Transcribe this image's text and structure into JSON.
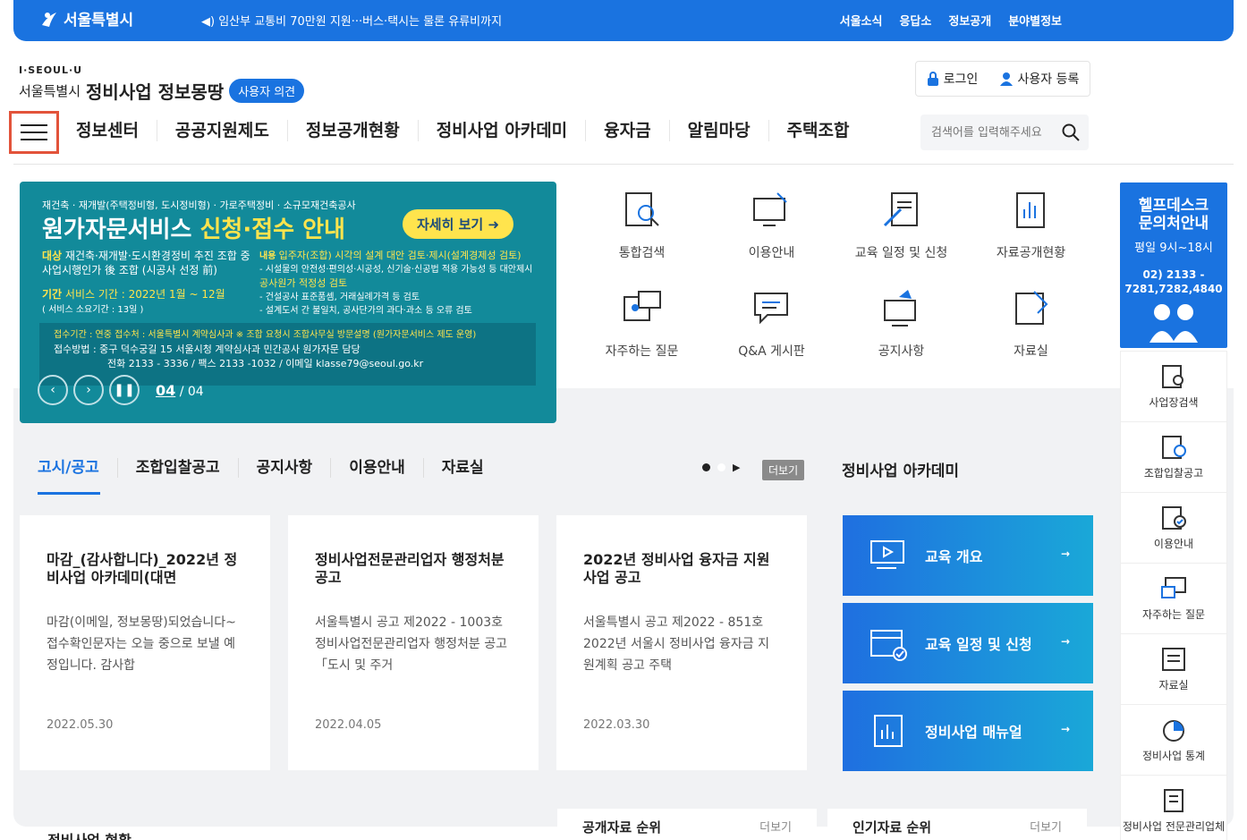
{
  "topbar": {
    "logo": "서울특별시",
    "notice": "◀) 임산부 교통비 70만원 지원···버스·택시는 물론 유류비까지",
    "links": [
      "서울소식",
      "응답소",
      "정보공개",
      "분야별정보"
    ]
  },
  "brand": {
    "slogan": "I·SEOUL·U",
    "city": "서울특별시",
    "title": "정비사업 정보몽땅",
    "badge": "사용자 의견"
  },
  "auth": {
    "login": "로그인",
    "register": "사용자 등록"
  },
  "gnb": [
    "정보센터",
    "공공지원제도",
    "정보공개현황",
    "정비사업 아카데미",
    "융자금",
    "알림마당",
    "주택조합"
  ],
  "search": {
    "placeholder": "검색어를 입력해주세요"
  },
  "banner": {
    "line1": "재건축 · 재개발(주택정비형, 도시정비형) · 가로주택정비 · 소규모재건축공사",
    "title_a": "원가자문서비스 ",
    "title_b": "신청·접수 안내",
    "more": "자세히 보기",
    "target_label": "대상",
    "target": "재건축·재개발·도시환경정비 추진 조합 중 사업시행인가 後 조합 (시공사 선정 前)",
    "content_label": "내용",
    "content1": "입주자(조합) 시각의 설계 대안 검토·제시(설계경제성 검토)",
    "content2": "- 시설물의 안전성·편의성·시공성, 신기술·신공법 적용 가능성 등 대안제시",
    "content3": "공사원가 적정성 검토",
    "content4": "- 건설공사 표준품셈, 거래실례가격 등 검토",
    "content5": "- 설계도서 간 불일치, 공사단가의 과다·과소 등 오류 검토",
    "period_label": "기간",
    "period": "서비스 기간 : 2022년 1월 ~ 12월",
    "period2": "( 서비스 소요기간 : 13일 )",
    "recv1": "접수기간 : 연중      접수처 : 서울특별시 계약심사과 ※ 조합 요청시 조합사무실 방문설명 (원가자문서비스 제도 운영)",
    "recv2": "접수방법 : 중구 덕수궁길 15 서울시청 계약심사과 민간공사 원가자문 담당",
    "recv3": "전화 2133 - 3336 / 팩스 2133 -1032 / 이메일 klasse79@seoul.go.kr",
    "page_current": "04",
    "page_total": "04"
  },
  "quick": [
    "통합검색",
    "이용안내",
    "교육 일정 및 신청",
    "자료공개현황",
    "자주하는 질문",
    "Q&A 게시판",
    "공지사항",
    "자료실"
  ],
  "helpdesk": {
    "title1": "헬프데스크",
    "title2": "문의처안내",
    "hours": "평일 9시~18시",
    "phone": "02) 2133 - 7281,7282,4840"
  },
  "side": [
    "사업장검색",
    "조합입찰공고",
    "이용안내",
    "자주하는 질문",
    "자료실",
    "정비사업 통계",
    "정비사업 전문관리업체"
  ],
  "tabs": [
    "고시/공고",
    "조합입찰공고",
    "공지사항",
    "이용안내",
    "자료실"
  ],
  "more_label": "더보기",
  "academy_title": "정비사업 아카데미",
  "cards": [
    {
      "title": "마감_(감사합니다)_2022년 정비사업 아카데미(대면",
      "body": "마감(이메일, 정보몽땅)되었습니다~ 접수확인문자는 오늘 중으로 보낼 예정입니다. 감사합",
      "date": "2022.05.30"
    },
    {
      "title": "정비사업전문관리업자 행정처분 공고",
      "body": "서울특별시 공고 제2022 - 1003호 정비사업전문관리업자 행정처분 공고「도시 및 주거",
      "date": "2022.04.05"
    },
    {
      "title": "2022년 정비사업 융자금 지원사업 공고",
      "body": "서울특별시 공고 제2022 - 851호2022년 서울시 정비사업 융자금 지원계획 공고 주택",
      "date": "2022.03.30"
    }
  ],
  "academy": [
    "교육 개요",
    "교육 일정 및 신청",
    "정비사업 매뉴얼"
  ],
  "rank": [
    {
      "title": "공개자료 순위",
      "more": "더보기"
    },
    {
      "title": "인기자료 순위",
      "more": "더보기"
    }
  ],
  "bottom_label": "정비사업 현황",
  "colors": {
    "primary": "#1a73e0",
    "banner": "#128a9a",
    "highlight": "#ffe44d"
  }
}
